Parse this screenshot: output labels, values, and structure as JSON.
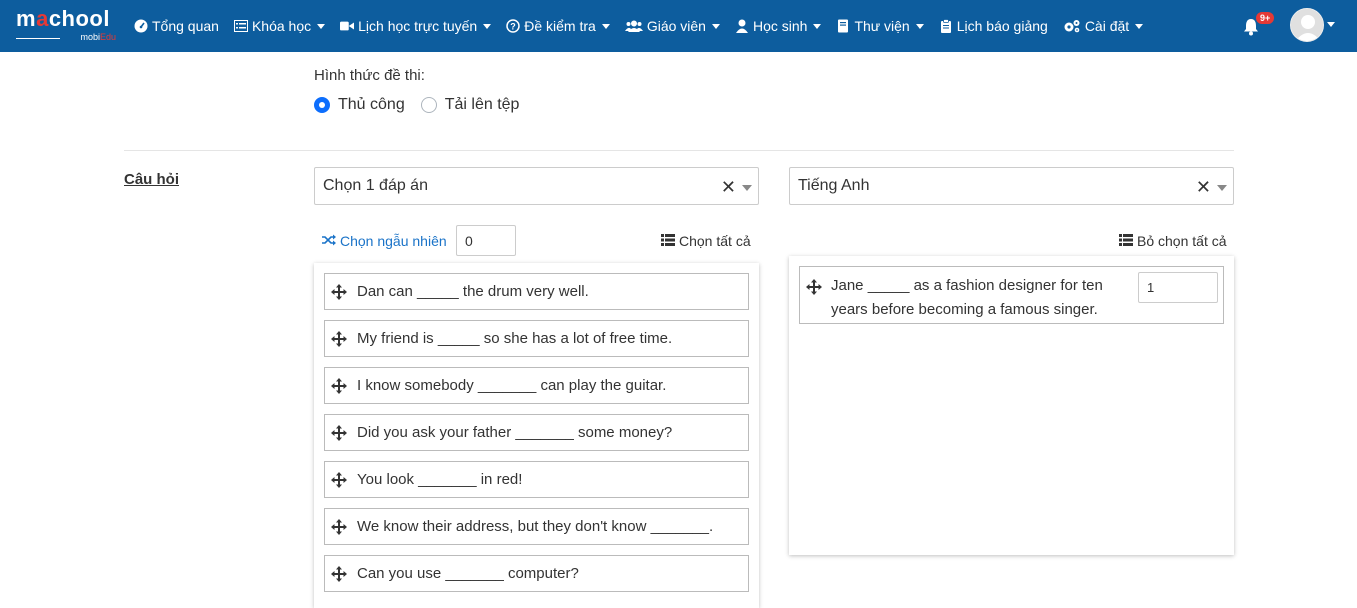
{
  "brand": {
    "name_prefix": "m",
    "name_o": "a",
    "name_suffix": "chool",
    "sub_a": "mobi",
    "sub_b": "Edu"
  },
  "nav": {
    "items": [
      {
        "label": "Tổng quan",
        "icon": "dashboard-icon",
        "dropdown": false
      },
      {
        "label": "Khóa học",
        "icon": "list-icon",
        "dropdown": true
      },
      {
        "label": "Lịch học trực tuyến",
        "icon": "video-icon",
        "dropdown": true
      },
      {
        "label": "Đề kiểm tra",
        "icon": "question-icon",
        "dropdown": true
      },
      {
        "label": "Giáo viên",
        "icon": "users-icon",
        "dropdown": true
      },
      {
        "label": "Học sinh",
        "icon": "user-icon",
        "dropdown": true
      },
      {
        "label": "Thư viện",
        "icon": "book-icon",
        "dropdown": true
      },
      {
        "label": "Lịch báo giảng",
        "icon": "clipboard-icon",
        "dropdown": false
      },
      {
        "label": "Cài đặt",
        "icon": "gears-icon",
        "dropdown": true
      }
    ],
    "notification_count": "9+"
  },
  "form": {
    "exam_type_label": "Hình thức đề thi:",
    "exam_type_options": [
      {
        "label": "Thủ công",
        "checked": true
      },
      {
        "label": "Tải lên tệp",
        "checked": false
      }
    ],
    "questions_label": "Câu hỏi",
    "answer_type_select": "Chọn 1 đáp án",
    "subject_select": "Tiếng Anh",
    "random_label": "Chọn ngẫu nhiên",
    "random_value": "0",
    "select_all_label": "Chọn tất cả",
    "deselect_all_label": "Bỏ chọn tất cả"
  },
  "available_questions": [
    "Dan can _____ the drum very well.",
    "My friend is _____ so she has a lot of free time.",
    "I know somebody _______ can play the guitar.",
    "Did you ask your father _______ some money?",
    "You look _______ in red!",
    "We know their address, but they don't know _______.",
    "Can you use _______ computer?"
  ],
  "selected_questions": [
    {
      "text": "Jane _____ as a fashion designer for ten years before becoming a famous singer.",
      "score": "1"
    }
  ],
  "colors": {
    "navbar": "#0d5d9e",
    "link": "#1a73c8",
    "radio_checked": "#0d6efd",
    "badge": "#e53935"
  }
}
